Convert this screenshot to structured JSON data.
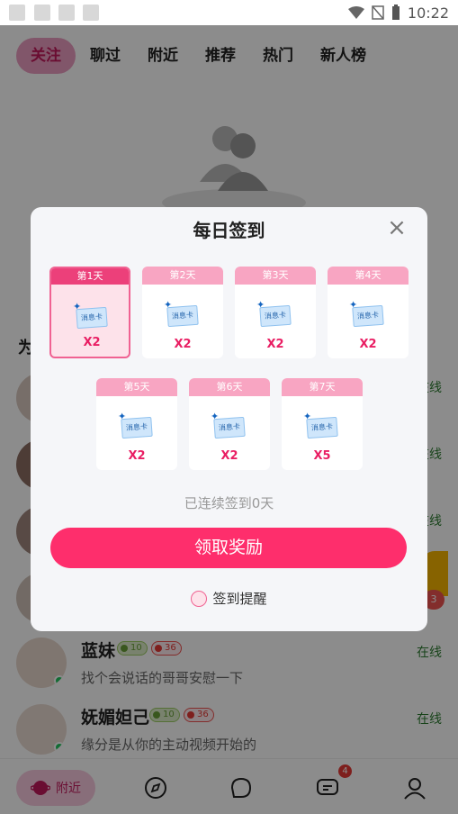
{
  "status_bar": {
    "time": "10:22"
  },
  "tabs": [
    {
      "label": "关注",
      "active": true
    },
    {
      "label": "聊过"
    },
    {
      "label": "附近"
    },
    {
      "label": "推荐"
    },
    {
      "label": "热门"
    },
    {
      "label": "新人榜"
    }
  ],
  "section_head": "为",
  "list": [
    {
      "name": "",
      "msg": "",
      "online": "在线"
    },
    {
      "name": "",
      "msg": "",
      "online": "在线"
    },
    {
      "name": "",
      "msg": "",
      "online": "在线"
    },
    {
      "name": "",
      "msg": "",
      "online": ""
    },
    {
      "name": "蓝妹",
      "badge_green": "10",
      "badge_red": "36",
      "msg": "找个会说话的哥哥安慰一下",
      "online": "在线"
    },
    {
      "name": "妩媚妲己",
      "badge_green": "10",
      "badge_red": "36",
      "msg": "缘分是从你的主动视频开始的",
      "online": "在线"
    }
  ],
  "gift_badge": "3",
  "bottom_nav": {
    "nearby_label": "附近",
    "messages_badge": "4"
  },
  "dialog": {
    "title": "每日签到",
    "days": [
      {
        "label": "第1天",
        "card": "消息卡",
        "mult": "X2",
        "active": true
      },
      {
        "label": "第2天",
        "card": "消息卡",
        "mult": "X2"
      },
      {
        "label": "第3天",
        "card": "消息卡",
        "mult": "X2"
      },
      {
        "label": "第4天",
        "card": "消息卡",
        "mult": "X2"
      },
      {
        "label": "第5天",
        "card": "消息卡",
        "mult": "X2"
      },
      {
        "label": "第6天",
        "card": "消息卡",
        "mult": "X2"
      },
      {
        "label": "第7天",
        "card": "消息卡",
        "mult": "X5"
      }
    ],
    "streak_text": "已连续签到0天",
    "claim_label": "领取奖励",
    "remind_label": "签到提醒"
  },
  "colors": {
    "accent": "#fe2e6c",
    "active_tab_bg": "#ec9dc2",
    "online": "#2e7d32"
  }
}
